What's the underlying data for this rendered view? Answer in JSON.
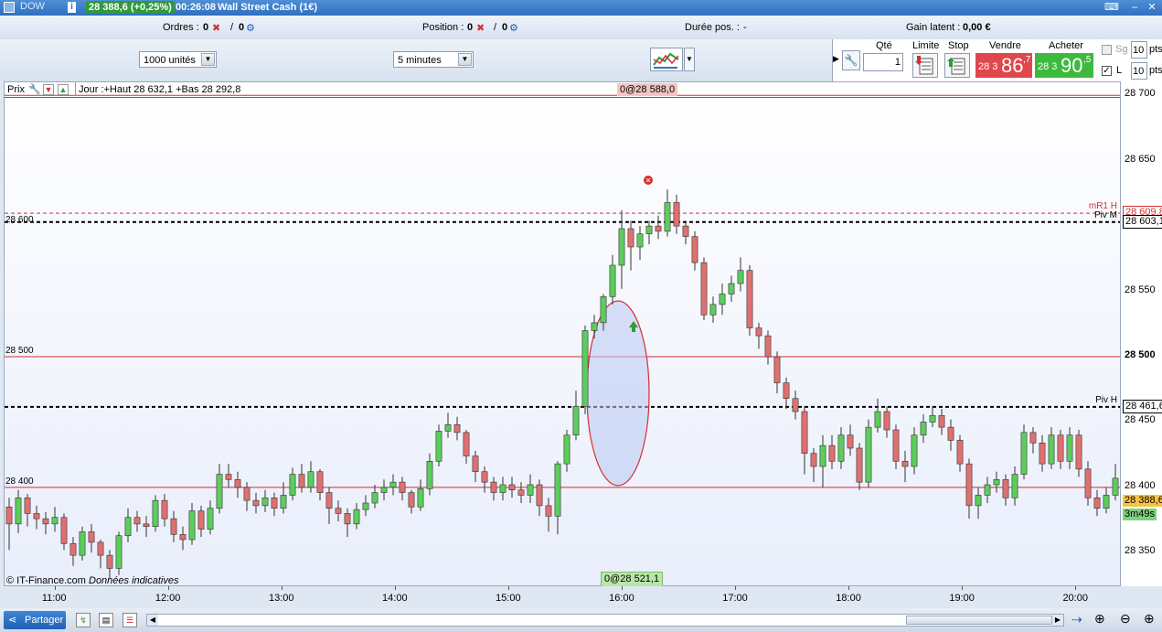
{
  "titlebar": {
    "symbol": "DOW",
    "last_price": "28 388,6 (+0,25%)",
    "clock": "00:26:08",
    "instrument": "Wall Street Cash (1€)"
  },
  "status": {
    "orders_label": "Ordres :",
    "orders_count": "0",
    "orders_sep": "/",
    "orders_total": "0",
    "position_label": "Position :",
    "position_count": "0",
    "position_sep": "/",
    "position_total": "0",
    "duration_label": "Durée pos. :",
    "duration_value": "-",
    "gain_label": "Gain latent :",
    "gain_value": "0,00 €"
  },
  "toolbar": {
    "units_select": "1000 unités",
    "period_select": "5 minutes",
    "qty_label": "Qté",
    "qty_value": "1",
    "limit_label": "Limite",
    "stop_label": "Stop",
    "sell_label": "Vendre",
    "buy_label": "Acheter",
    "sell_prefix": "28 3",
    "sell_big": "86",
    "sell_sup": ",7",
    "buy_prefix": "28 3",
    "buy_big": "90",
    "buy_sup": ",5",
    "sg_label": "Sg",
    "sg_value": "10",
    "sg_unit": "pts",
    "l_label": "L",
    "l_value": "10",
    "l_unit": "pts"
  },
  "chart_header": {
    "price_label": "Prix",
    "day_info": "Jour :+Haut 28 632,1 +Bas 28 292,8",
    "top_marker": "0@28 588,0",
    "bottom_marker": "0@28 521,1",
    "credit_brand": "© IT-Finance.com",
    "credit_note": "Données indicatives"
  },
  "chart_data": {
    "type": "candlestick",
    "instrument": "Wall Street Cash (1€)",
    "period": "5 minutes",
    "ylim": [
      28325,
      28710
    ],
    "xlim": [
      "10:33",
      "20:23"
    ],
    "y_ticks": [
      "28 700",
      "28 650",
      "28 600",
      "28 550",
      "28 500",
      "28 450",
      "28 400",
      "28 350"
    ],
    "x_ticks": [
      "11:00",
      "12:00",
      "13:00",
      "14:00",
      "15:00",
      "16:00",
      "17:00",
      "18:00",
      "19:00",
      "20:00"
    ],
    "left_labels": [
      {
        "text": "28 600",
        "value": 28600
      },
      {
        "text": "28 500",
        "value": 28500
      },
      {
        "text": "28 400",
        "value": 28400
      }
    ],
    "levels": [
      {
        "name": "mR1 H",
        "value": 28609.8,
        "label": "28 609,8",
        "color": "#d62f2f",
        "style": "dashed"
      },
      {
        "name": "Piv M",
        "value": 28603.1,
        "label": "28 603,1",
        "color": "#000000",
        "style": "dashed"
      },
      {
        "name": "Piv H",
        "value": 28461.6,
        "label": "28 461,6",
        "color": "#000000",
        "style": "dashed"
      },
      {
        "name": "",
        "value": 28700,
        "color": "#d62f2f",
        "style": "solid"
      },
      {
        "name": "",
        "value": 28500,
        "color": "#d62f2f",
        "style": "solid"
      },
      {
        "name": "",
        "value": 28400,
        "color": "#d62f2f",
        "style": "solid"
      }
    ],
    "last": {
      "value": 28388.6,
      "label": "28 388,6",
      "countdown": "3m49s"
    },
    "candles": [
      [
        28385,
        28372,
        28392,
        28352
      ],
      [
        28372,
        28392,
        28398,
        28365
      ],
      [
        28392,
        28380,
        28395,
        28370
      ],
      [
        28380,
        28376,
        28386,
        28368
      ],
      [
        28376,
        28372,
        28381,
        28364
      ],
      [
        28372,
        28377,
        28385,
        28366
      ],
      [
        28377,
        28357,
        28380,
        28352
      ],
      [
        28357,
        28348,
        28362,
        28340
      ],
      [
        28348,
        28366,
        28370,
        28344
      ],
      [
        28366,
        28358,
        28372,
        28350
      ],
      [
        28358,
        28348,
        28360,
        28338
      ],
      [
        28348,
        28338,
        28352,
        28330
      ],
      [
        28338,
        28363,
        28366,
        28333
      ],
      [
        28363,
        28377,
        28384,
        28358
      ],
      [
        28377,
        28372,
        28382,
        28366
      ],
      [
        28372,
        28370,
        28378,
        28362
      ],
      [
        28370,
        28390,
        28394,
        28366
      ],
      [
        28390,
        28376,
        28395,
        28370
      ],
      [
        28376,
        28364,
        28382,
        28358
      ],
      [
        28364,
        28360,
        28370,
        28352
      ],
      [
        28360,
        28382,
        28388,
        28356
      ],
      [
        28382,
        28368,
        28386,
        28362
      ],
      [
        28368,
        28384,
        28390,
        28364
      ],
      [
        28384,
        28410,
        28418,
        28380
      ],
      [
        28410,
        28406,
        28418,
        28400
      ],
      [
        28406,
        28400,
        28412,
        28392
      ],
      [
        28400,
        28390,
        28404,
        28382
      ],
      [
        28390,
        28386,
        28396,
        28380
      ],
      [
        28386,
        28392,
        28398,
        28381
      ],
      [
        28392,
        28384,
        28396,
        28378
      ],
      [
        28384,
        28394,
        28404,
        28380
      ],
      [
        28394,
        28410,
        28415,
        28390
      ],
      [
        28410,
        28400,
        28418,
        28396
      ],
      [
        28400,
        28412,
        28420,
        28396
      ],
      [
        28412,
        28396,
        28414,
        28390
      ],
      [
        28396,
        28384,
        28400,
        28372
      ],
      [
        28384,
        28380,
        28390,
        28374
      ],
      [
        28380,
        28372,
        28384,
        28362
      ],
      [
        28372,
        28383,
        28388,
        28368
      ],
      [
        28383,
        28388,
        28394,
        28378
      ],
      [
        28388,
        28396,
        28402,
        28384
      ],
      [
        28396,
        28400,
        28406,
        28390
      ],
      [
        28400,
        28404,
        28410,
        28394
      ],
      [
        28404,
        28396,
        28408,
        28390
      ],
      [
        28396,
        28385,
        28398,
        28380
      ],
      [
        28385,
        28399,
        28406,
        28382
      ],
      [
        28399,
        28420,
        28426,
        28394
      ],
      [
        28420,
        28443,
        28448,
        28416
      ],
      [
        28443,
        28448,
        28457,
        28438
      ],
      [
        28448,
        28442,
        28454,
        28436
      ],
      [
        28442,
        28424,
        28444,
        28418
      ],
      [
        28424,
        28412,
        28428,
        28404
      ],
      [
        28412,
        28404,
        28416,
        28396
      ],
      [
        28404,
        28396,
        28408,
        28390
      ],
      [
        28396,
        28402,
        28408,
        28390
      ],
      [
        28402,
        28398,
        28408,
        28392
      ],
      [
        28398,
        28394,
        28404,
        28388
      ],
      [
        28394,
        28402,
        28410,
        28388
      ],
      [
        28402,
        28386,
        28406,
        28378
      ],
      [
        28386,
        28378,
        28392,
        28366
      ],
      [
        28378,
        28418,
        28420,
        28364
      ],
      [
        28418,
        28440,
        28444,
        28412
      ],
      [
        28440,
        28462,
        28474,
        28436
      ],
      [
        28462,
        28520,
        28524,
        28456
      ],
      [
        28520,
        28526,
        28532,
        28514
      ],
      [
        28526,
        28546,
        28548,
        28520
      ],
      [
        28546,
        28570,
        28578,
        28540
      ],
      [
        28570,
        28598,
        28612,
        28552
      ],
      [
        28598,
        28584,
        28604,
        28566
      ],
      [
        28584,
        28594,
        28600,
        28574
      ],
      [
        28594,
        28600,
        28604,
        28586
      ],
      [
        28600,
        28596,
        28608,
        28590
      ],
      [
        28596,
        28618,
        28628,
        28592
      ],
      [
        28618,
        28600,
        28624,
        28594
      ],
      [
        28600,
        28592,
        28604,
        28586
      ],
      [
        28592,
        28572,
        28596,
        28566
      ],
      [
        28572,
        28532,
        28576,
        28528
      ],
      [
        28532,
        28540,
        28546,
        28526
      ],
      [
        28540,
        28548,
        28556,
        28532
      ],
      [
        28548,
        28556,
        28562,
        28542
      ],
      [
        28556,
        28566,
        28576,
        28550
      ],
      [
        28566,
        28522,
        28570,
        28516
      ],
      [
        28522,
        28516,
        28526,
        28506
      ],
      [
        28516,
        28500,
        28520,
        28494
      ],
      [
        28500,
        28480,
        28504,
        28472
      ],
      [
        28480,
        28468,
        28484,
        28460
      ],
      [
        28468,
        28458,
        28474,
        28452
      ],
      [
        28458,
        28426,
        28462,
        28410
      ],
      [
        28426,
        28416,
        28430,
        28404
      ],
      [
        28416,
        28432,
        28440,
        28400
      ],
      [
        28432,
        28420,
        28440,
        28414
      ],
      [
        28420,
        28440,
        28446,
        28414
      ],
      [
        28440,
        28430,
        28448,
        28424
      ],
      [
        28430,
        28404,
        28434,
        28398
      ],
      [
        28404,
        28446,
        28452,
        28400
      ],
      [
        28446,
        28458,
        28468,
        28442
      ],
      [
        28458,
        28444,
        28462,
        28438
      ],
      [
        28444,
        28420,
        28448,
        28414
      ],
      [
        28420,
        28416,
        28428,
        28404
      ],
      [
        28416,
        28440,
        28446,
        28410
      ],
      [
        28440,
        28450,
        28456,
        28434
      ],
      [
        28450,
        28455,
        28462,
        28446
      ],
      [
        28455,
        28446,
        28460,
        28440
      ],
      [
        28446,
        28436,
        28452,
        28428
      ],
      [
        28436,
        28418,
        28440,
        28412
      ],
      [
        28418,
        28386,
        28422,
        28376
      ],
      [
        28386,
        28394,
        28400,
        28376
      ],
      [
        28394,
        28402,
        28408,
        28388
      ],
      [
        28402,
        28406,
        28412,
        28396
      ],
      [
        28406,
        28392,
        28410,
        28386
      ],
      [
        28392,
        28410,
        28416,
        28386
      ],
      [
        28410,
        28442,
        28448,
        28406
      ],
      [
        28442,
        28434,
        28446,
        28426
      ],
      [
        28434,
        28418,
        28440,
        28412
      ],
      [
        28418,
        28440,
        28446,
        28414
      ],
      [
        28440,
        28420,
        28444,
        28414
      ],
      [
        28420,
        28440,
        28446,
        28414
      ],
      [
        28440,
        28414,
        28444,
        28408
      ],
      [
        28414,
        28392,
        28420,
        28386
      ],
      [
        28392,
        28384,
        28398,
        28378
      ],
      [
        28384,
        28394,
        28400,
        28380
      ],
      [
        28394,
        28407,
        28418,
        28390
      ]
    ]
  },
  "bottom": {
    "share_label": "Partager"
  }
}
